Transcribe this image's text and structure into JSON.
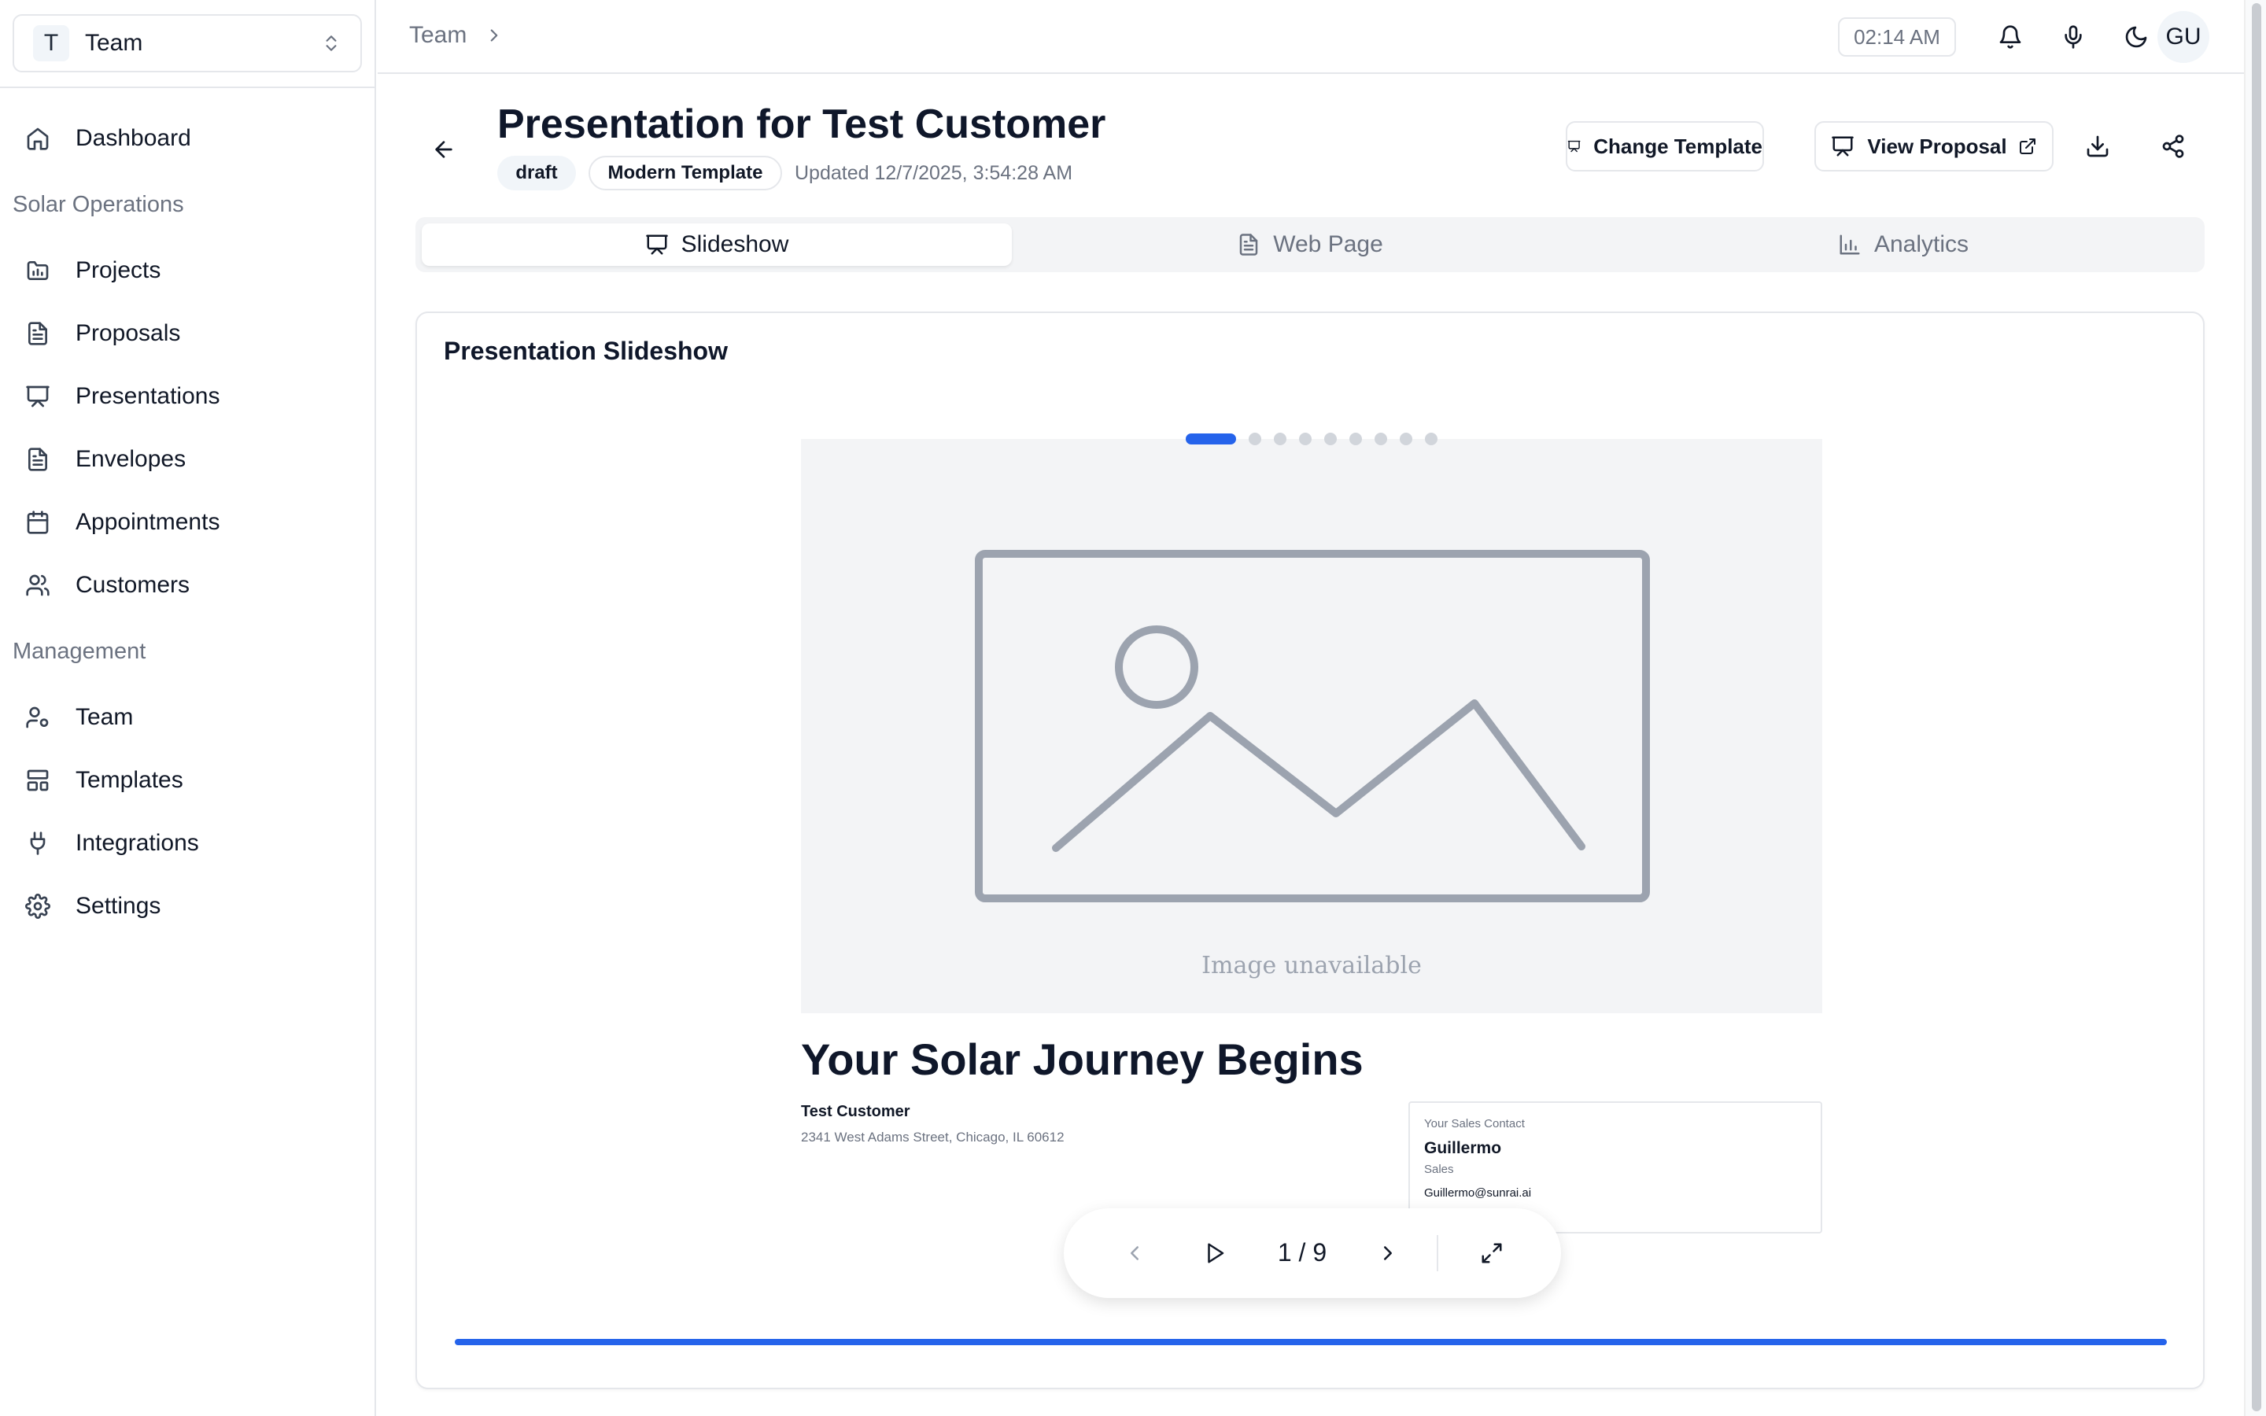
{
  "sidebar": {
    "team_avatar": "T",
    "team_name": "Team",
    "items_top": [
      {
        "label": "Dashboard",
        "icon": "home-icon"
      }
    ],
    "section_ops": "Solar Operations",
    "items_ops": [
      {
        "label": "Projects",
        "icon": "folder-chart-icon"
      },
      {
        "label": "Proposals",
        "icon": "file-text-icon"
      },
      {
        "label": "Presentations",
        "icon": "presentation-icon"
      },
      {
        "label": "Envelopes",
        "icon": "file-text-icon"
      },
      {
        "label": "Appointments",
        "icon": "calendar-icon"
      },
      {
        "label": "Customers",
        "icon": "users-icon"
      }
    ],
    "section_mgmt": "Management",
    "items_mgmt": [
      {
        "label": "Team",
        "icon": "user-cog-icon"
      },
      {
        "label": "Templates",
        "icon": "layout-icon"
      },
      {
        "label": "Integrations",
        "icon": "plug-icon"
      },
      {
        "label": "Settings",
        "icon": "gear-icon"
      }
    ]
  },
  "topbar": {
    "breadcrumb": "Team",
    "time": "02:14 AM",
    "user_initials": "GU"
  },
  "header": {
    "title": "Presentation for Test Customer",
    "status_badge": "draft",
    "template_badge": "Modern Template",
    "updated": "Updated 12/7/2025, 3:54:28 AM",
    "change_template_label": "Change Template",
    "view_proposal_label": "View Proposal"
  },
  "tabs": [
    {
      "label": "Slideshow",
      "icon": "presentation-icon",
      "active": true
    },
    {
      "label": "Web Page",
      "icon": "file-text-icon",
      "active": false
    },
    {
      "label": "Analytics",
      "icon": "bar-chart-icon",
      "active": false
    }
  ],
  "slideshow": {
    "card_title": "Presentation Slideshow",
    "current_slide": 1,
    "total_slides": 9,
    "counter": "1 / 9",
    "progress": 1.0,
    "slide": {
      "image_caption": "Image unavailable",
      "heading": "Your Solar Journey Begins",
      "customer_name": "Test Customer",
      "customer_address": "2341 West Adams Street, Chicago, IL 60612",
      "contact_label": "Your Sales Contact",
      "contact_name": "Guillermo",
      "contact_role": "Sales",
      "contact_email": "Guillermo@sunrai.ai"
    }
  },
  "colors": {
    "accent": "#2563eb",
    "muted_text": "#6b7280",
    "border": "#e5e7eb",
    "placeholder_stroke": "#9ca3af"
  }
}
